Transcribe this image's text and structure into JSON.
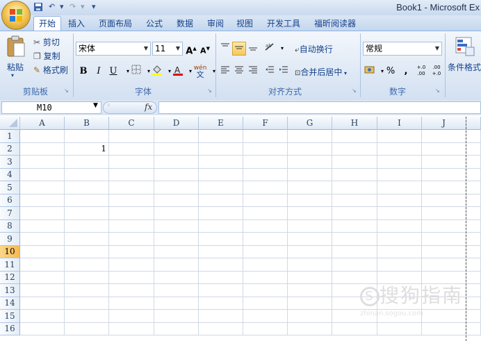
{
  "window": {
    "title": "Book1 - Microsoft Ex"
  },
  "quick_access": {
    "undo": "↶",
    "redo": "↷",
    "dropdown": "▾"
  },
  "tabs": [
    {
      "label": "开始",
      "active": true
    },
    {
      "label": "插入"
    },
    {
      "label": "页面布局"
    },
    {
      "label": "公式"
    },
    {
      "label": "数据"
    },
    {
      "label": "审阅"
    },
    {
      "label": "视图"
    },
    {
      "label": "开发工具"
    },
    {
      "label": "福昕阅读器"
    }
  ],
  "ribbon": {
    "clipboard": {
      "paste": "粘贴",
      "cut": "剪切",
      "copy": "复制",
      "format_painter": "格式刷",
      "group_label": "剪贴板"
    },
    "font": {
      "name": "宋体",
      "size": "11",
      "bold": "B",
      "italic": "I",
      "underline": "U",
      "wen": "wén",
      "group_label": "字体",
      "grow": "A",
      "shrink": "A"
    },
    "alignment": {
      "wrap_text": "自动换行",
      "merge_center": "合并后居中",
      "group_label": "对齐方式"
    },
    "number": {
      "format": "常规",
      "percent": "%",
      "comma": ",",
      "inc_dec": "+.0 .00",
      "dec_dec": ".00 +.0",
      "group_label": "数字"
    },
    "styles": {
      "conditional_format": "条件格式"
    }
  },
  "formula_bar": {
    "name_box": "M10",
    "fx": "fx",
    "value": ""
  },
  "columns": [
    "A",
    "B",
    "C",
    "D",
    "E",
    "F",
    "G",
    "H",
    "I",
    "J"
  ],
  "rows": [
    "1",
    "2",
    "3",
    "4",
    "5",
    "6",
    "7",
    "8",
    "9",
    "10",
    "11",
    "12",
    "13",
    "14",
    "15",
    "16"
  ],
  "cells": {
    "B2": "1"
  },
  "selected_row": "10",
  "watermark": {
    "main": "搜狗指南",
    "sub": "zhinan.sogou.com"
  }
}
